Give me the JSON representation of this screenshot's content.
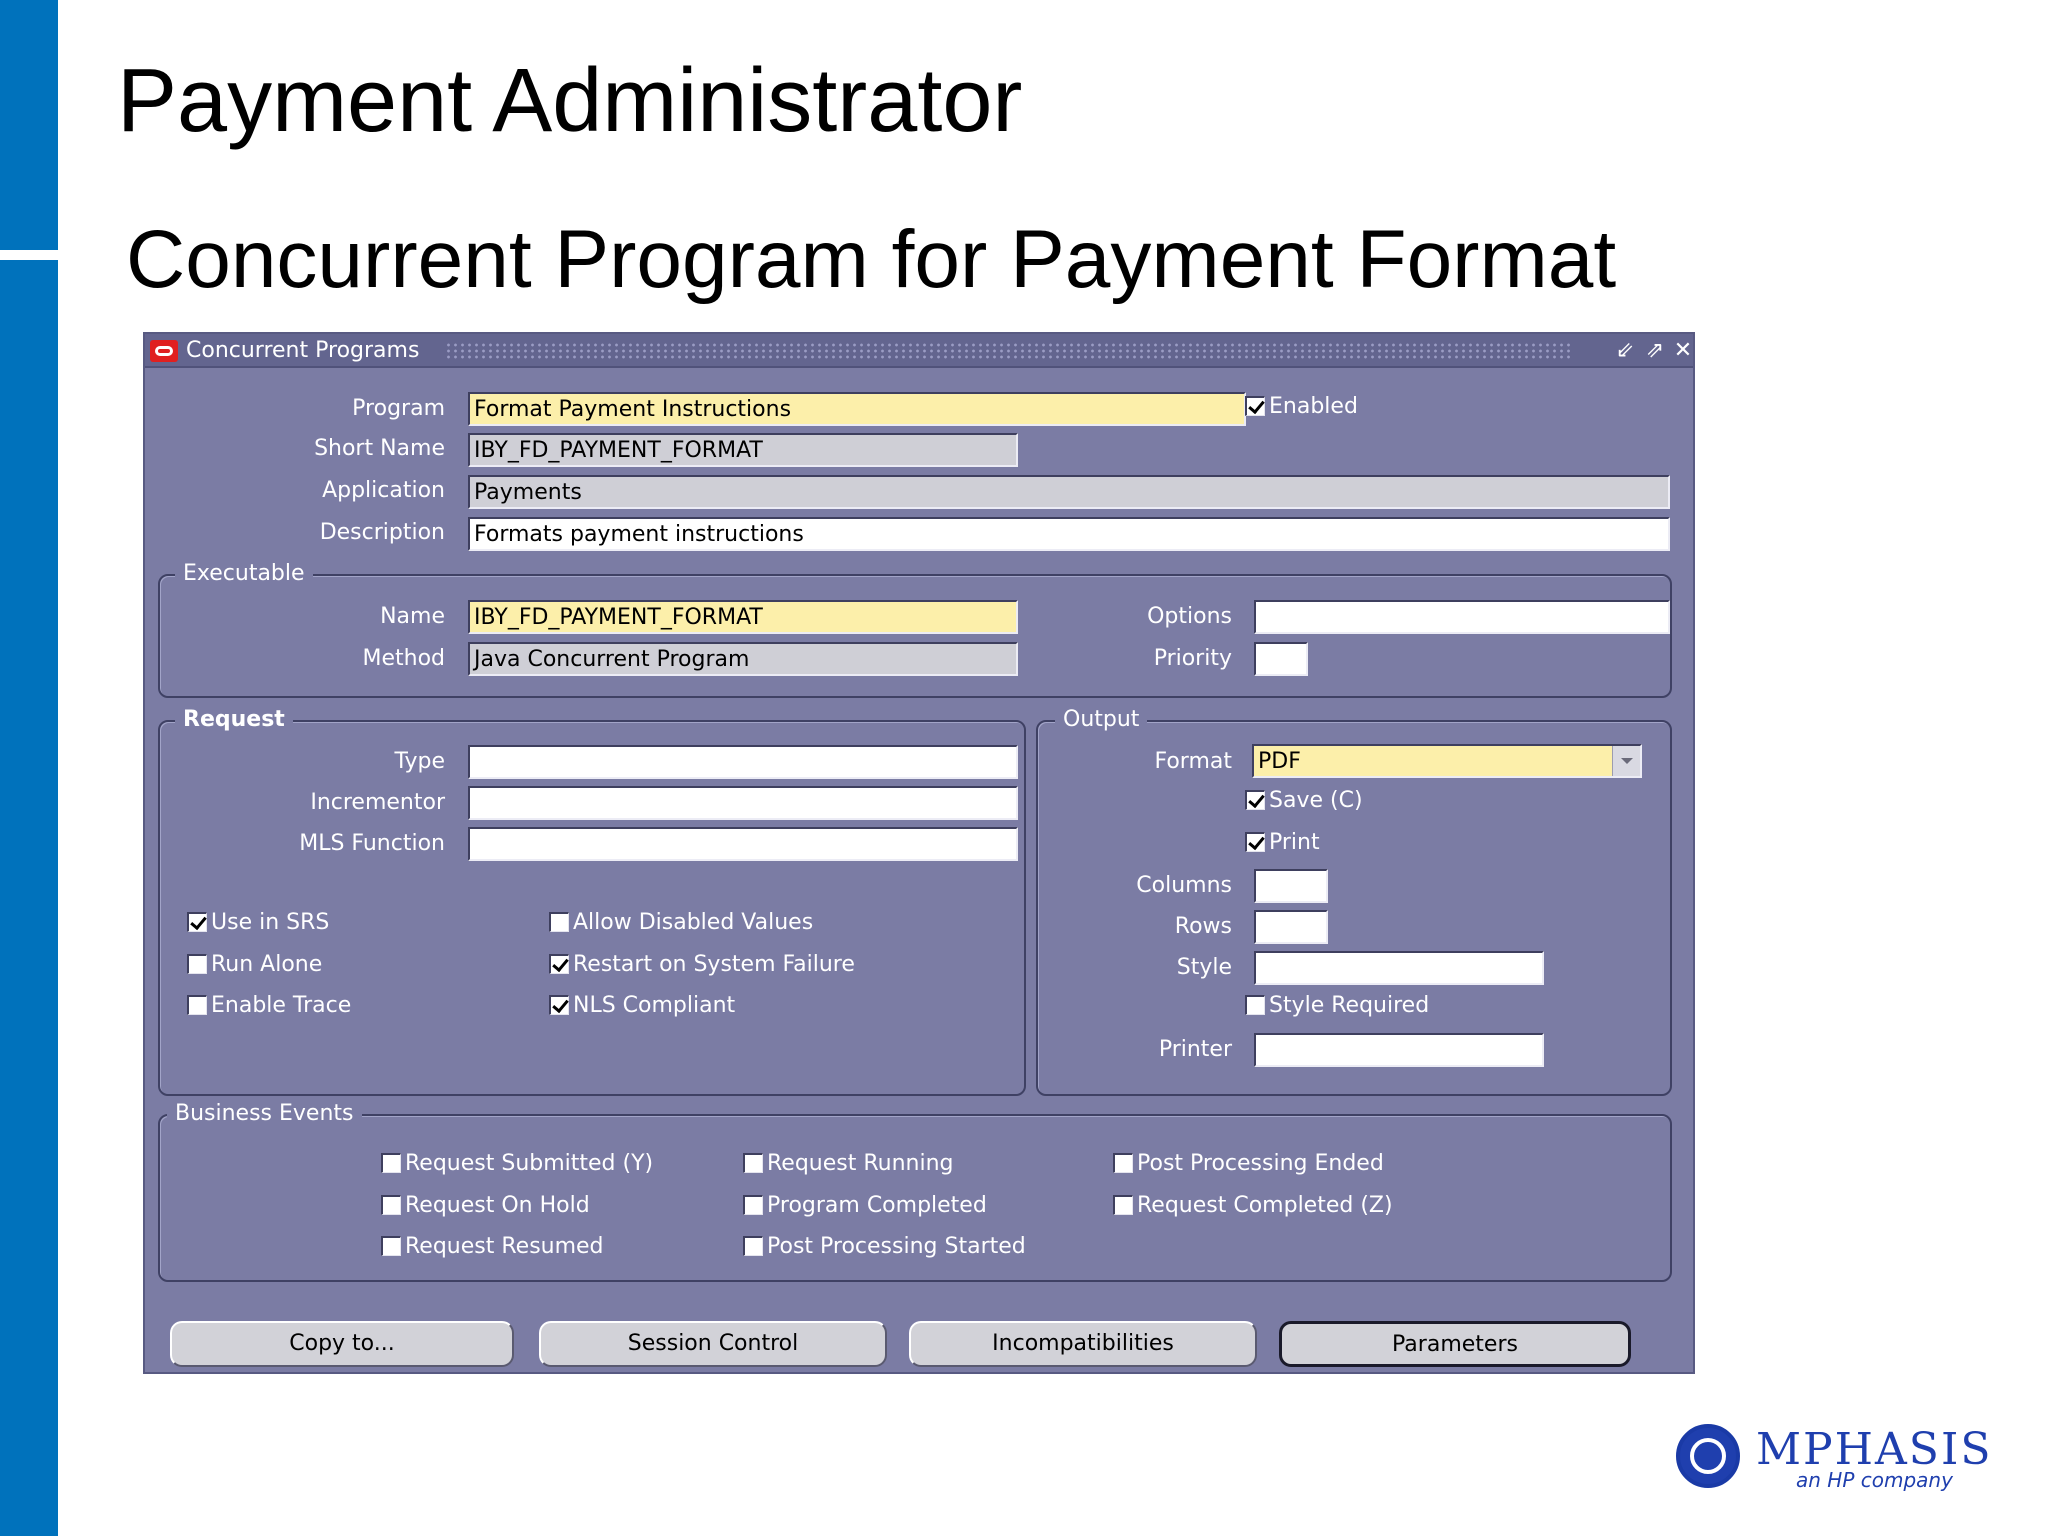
{
  "slide": {
    "title": "Payment Administrator",
    "subtitle": "Concurrent Program for Payment Format"
  },
  "window": {
    "title": "Concurrent Programs",
    "controls": [
      "minimize-icon",
      "maximize-icon",
      "close-icon"
    ]
  },
  "header": {
    "program_label": "Program",
    "program_value": "Format Payment Instructions",
    "enabled_label": "Enabled",
    "enabled_checked": true,
    "short_name_label": "Short Name",
    "short_name_value": "IBY_FD_PAYMENT_FORMAT",
    "application_label": "Application",
    "application_value": "Payments",
    "description_label": "Description",
    "description_value": "Formats payment instructions"
  },
  "executable": {
    "title": "Executable",
    "name_label": "Name",
    "name_value": "IBY_FD_PAYMENT_FORMAT",
    "method_label": "Method",
    "method_value": "Java Concurrent Program",
    "options_label": "Options",
    "options_value": "",
    "priority_label": "Priority",
    "priority_value": ""
  },
  "request": {
    "title": "Request",
    "type_label": "Type",
    "type_value": "",
    "incrementor_label": "Incrementor",
    "incrementor_value": "",
    "mls_label": "MLS Function",
    "mls_value": "",
    "checkboxes": [
      {
        "label": "Use in SRS",
        "checked": true
      },
      {
        "label": "Run Alone",
        "checked": false
      },
      {
        "label": "Enable Trace",
        "checked": false
      },
      {
        "label": "Allow Disabled Values",
        "checked": false
      },
      {
        "label": "Restart on System Failure",
        "checked": true
      },
      {
        "label": "NLS Compliant",
        "checked": true
      }
    ]
  },
  "output": {
    "title": "Output",
    "format_label": "Format",
    "format_value": "PDF",
    "save_label": "Save (C)",
    "save_checked": true,
    "print_label": "Print",
    "print_checked": true,
    "columns_label": "Columns",
    "columns_value": "",
    "rows_label": "Rows",
    "rows_value": "",
    "style_label": "Style",
    "style_value": "",
    "style_required_label": "Style Required",
    "style_required_checked": false,
    "printer_label": "Printer",
    "printer_value": ""
  },
  "business_events": {
    "title": "Business Events",
    "items": [
      {
        "label": "Request Submitted (Y)",
        "checked": false
      },
      {
        "label": "Request On Hold",
        "checked": false
      },
      {
        "label": "Request Resumed",
        "checked": false
      },
      {
        "label": "Request Running",
        "checked": false
      },
      {
        "label": "Program Completed",
        "checked": false
      },
      {
        "label": "Post Processing Started",
        "checked": false
      },
      {
        "label": "Post Processing Ended",
        "checked": false
      },
      {
        "label": "Request Completed (Z)",
        "checked": false
      }
    ]
  },
  "buttons": {
    "copy_to": "Copy to...",
    "session_control": "Session Control",
    "incompatibilities": "Incompatibilities",
    "parameters": "Parameters"
  },
  "logo": {
    "name": "MPHASIS",
    "tagline": "an HP company"
  }
}
